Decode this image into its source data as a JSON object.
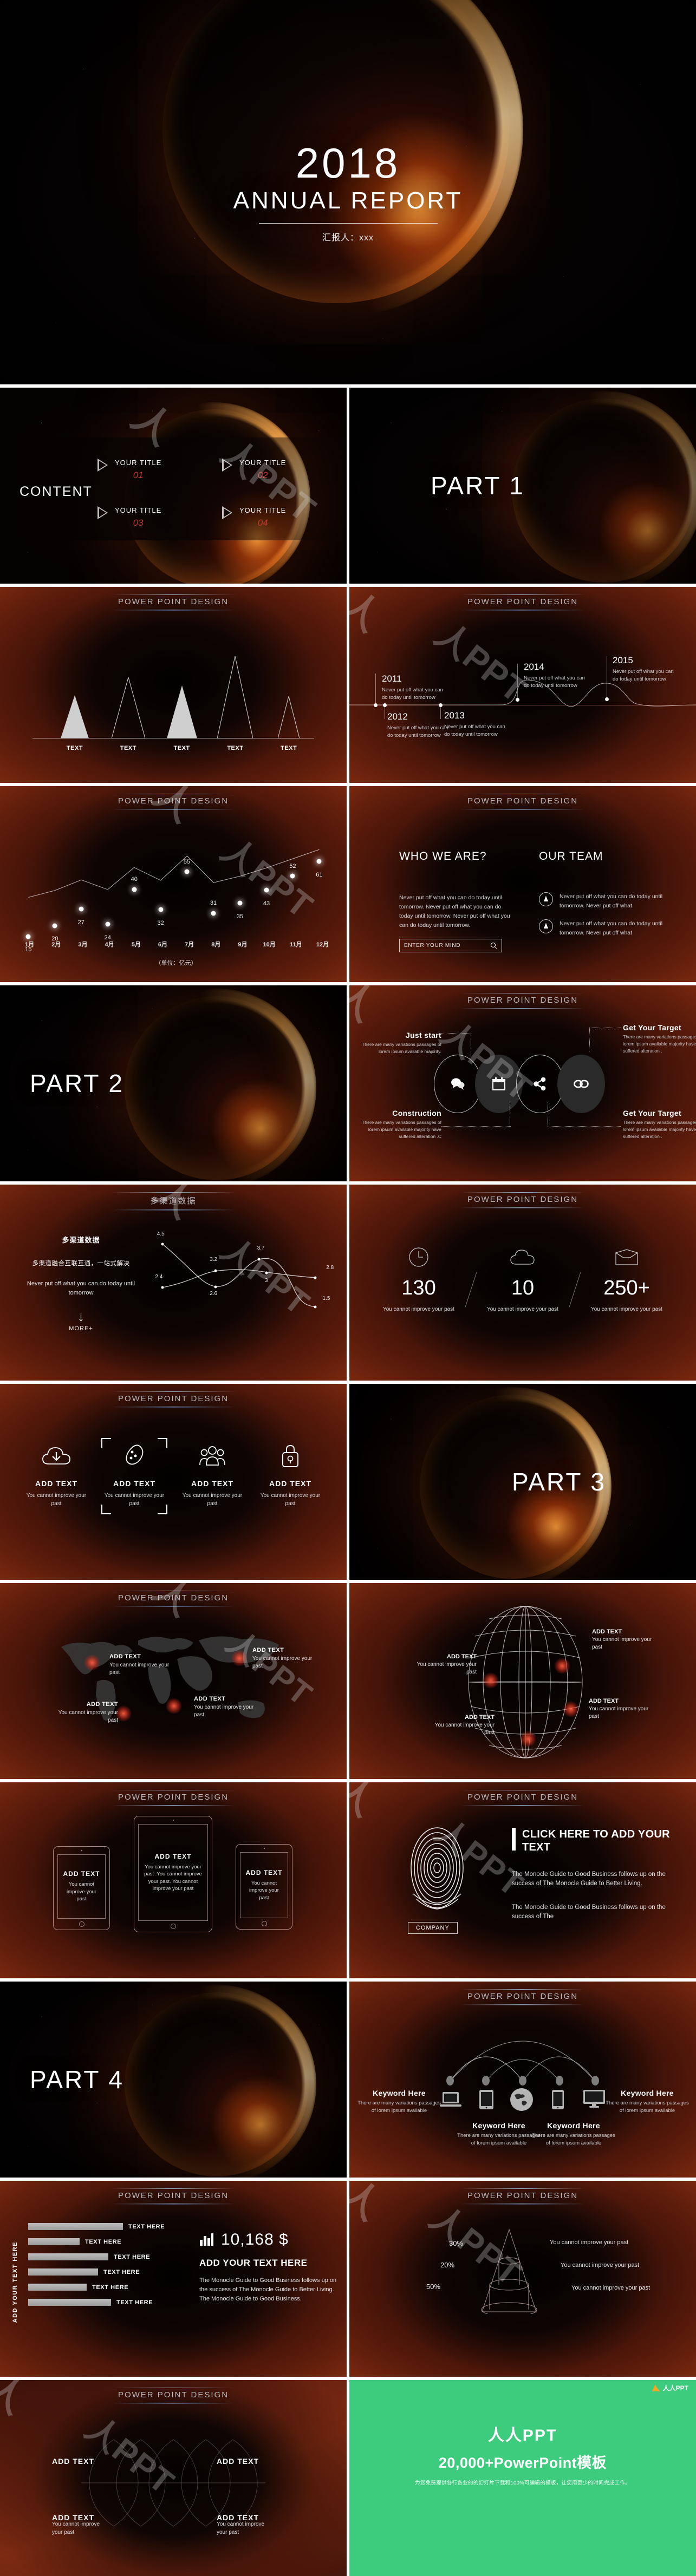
{
  "cover": {
    "year": "2018",
    "subtitle": "ANNUAL REPORT",
    "author": "汇报人：xxx"
  },
  "common": {
    "section_title": "POWER POINT DESIGN",
    "lorem_short": "Never put off what you can do today until tomorrow",
    "you_cannot": "You cannot improve your past",
    "add_text": "ADD TEXT",
    "add_text_sp": "ADD  TEXT",
    "text_here": "TEXT HERE",
    "variations": "There are many variations passages of lorem ipsum available"
  },
  "content": {
    "label": "CONTENT",
    "items": [
      {
        "title": "YOUR TITLE",
        "num": "01"
      },
      {
        "title": "YOUR TITLE",
        "num": "02"
      },
      {
        "title": "YOUR TITLE",
        "num": "03"
      },
      {
        "title": "YOUR TITLE",
        "num": "04"
      }
    ]
  },
  "parts": {
    "part1": "PART 1",
    "part2": "PART 2",
    "part3": "PART 3",
    "part4": "PART 4"
  },
  "triangle_slide": {
    "title": "POWER POINT DESIGN",
    "labels": [
      "TEXT",
      "TEXT",
      "TEXT",
      "TEXT",
      "TEXT"
    ]
  },
  "timeline": {
    "title": "POWER POINT DESIGN",
    "entries": [
      {
        "year": "2011",
        "text": "Never put off what you can do today until tomorrow"
      },
      {
        "year": "2012",
        "text": "Never put off what you can do today until tomorrow"
      },
      {
        "year": "2013",
        "text": "Never put off what you can do today until tomorrow"
      },
      {
        "year": "2014",
        "text": "Never put off what you can do today until tomorrow"
      },
      {
        "year": "2015",
        "text": "Never put off what you can do today until tomorrow"
      }
    ]
  },
  "who_we_are": {
    "title": "POWER POINT DESIGN",
    "heading_left": "WHO WE ARE?",
    "body_left": "Never put off what you can do today until tomorrow. Never put off what you can do today until tomorrow. Never put off what you can do today until tomorrow.",
    "search_placeholder": "ENTER YOUR MIND",
    "heading_right": "OUR TEAM",
    "team": [
      "Never put off what you can do today until tomorrow. Never put off what",
      "Never put off what you can do today until tomorrow. Never put off what"
    ]
  },
  "circles": {
    "title": "POWER POINT DESIGN",
    "labels": [
      {
        "h": "Just start",
        "p": "There are many variations passages of lorem ipsum available majority."
      },
      {
        "h": "Construction",
        "p": "There are many variations passages of lorem ipsum available majority have suffered alteration .C"
      },
      {
        "h": "Get Your Target",
        "p": "There are many variations passages of lorem ipsum available majority have suffered alteration ."
      },
      {
        "h": "Get Your Target",
        "p": "There are many variations passages of lorem ipsum available majority have suffered alteration ."
      }
    ],
    "icons": [
      "chat-icon",
      "calendar-icon",
      "share-icon",
      "link-icon"
    ]
  },
  "stats": {
    "title": "POWER POINT DESIGN",
    "items": [
      {
        "icon": "clock-icon",
        "value": "130",
        "caption": "You cannot improve your past"
      },
      {
        "icon": "cloud-icon",
        "value": "10",
        "caption": "You cannot improve your past"
      },
      {
        "icon": "inbox-icon",
        "value": "250+",
        "caption": "You cannot improve your past"
      }
    ]
  },
  "icon_cards": {
    "title": "POWER POINT DESIGN",
    "cards": [
      {
        "icon": "cloud-download-icon",
        "h": "ADD  TEXT",
        "p": "You cannot improve your past"
      },
      {
        "icon": "tag-icon",
        "h": "ADD  TEXT",
        "p": "You cannot improve your past"
      },
      {
        "icon": "people-icon",
        "h": "ADD  TEXT",
        "p": "You cannot improve your past"
      },
      {
        "icon": "lock-icon",
        "h": "ADD  TEXT",
        "p": "You cannot improve your past"
      }
    ]
  },
  "world_map": {
    "title": "POWER POINT DESIGN",
    "markers": [
      {
        "h": "ADD TEXT",
        "p": "You cannot improve your past"
      },
      {
        "h": "ADD TEXT",
        "p": "You cannot improve your past"
      },
      {
        "h": "ADD TEXT",
        "p": "You cannot improve your past"
      },
      {
        "h": "ADD TEXT",
        "p": "You cannot improve your past"
      }
    ]
  },
  "globe": {
    "markers": [
      {
        "h": "ADD TEXT",
        "p": "You cannot improve your past"
      },
      {
        "h": "ADD TEXT",
        "p": "You cannot improve your past"
      },
      {
        "h": "ADD TEXT",
        "p": "You cannot improve your past"
      },
      {
        "h": "ADD TEXT",
        "p": "You cannot improve your past"
      }
    ]
  },
  "tablets": {
    "title": "POWER POINT DESIGN",
    "devices": [
      {
        "h": "ADD  TEXT",
        "p": "You cannot improve your past"
      },
      {
        "h": "ADD  TEXT",
        "p": "You cannot improve your past .You cannot improve your past. You cannot improve your past"
      },
      {
        "h": "ADD  TEXT",
        "p": "You cannot improve your past"
      }
    ]
  },
  "fingerprint": {
    "title": "POWER POINT DESIGN",
    "heading": "CLICK HERE TO ADD YOUR TEXT",
    "p1": "The Monocle Guide to Good Business follows up on the success of The Monocle Guide to Better Living.",
    "p2": "The Monocle Guide to Good Business follows up on the success of The",
    "company": "COMPANY"
  },
  "keywords": {
    "title": "POWER POINT DESIGN",
    "items": [
      {
        "icon": "laptop-icon",
        "h": "Keyword Here",
        "p": "There are many variations passages of lorem ipsum available"
      },
      {
        "icon": "tablet-icon",
        "h": "Keyword Here",
        "p": "There are many variations passages of lorem ipsum available"
      },
      {
        "icon": "globe-icon",
        "h": "Keyword Here",
        "p": "There are many variations passages of lorem ipsum available"
      },
      {
        "icon": "phone-icon",
        "h": "Keyword Here",
        "p": "There are many variations passages of lorem ipsum available"
      },
      {
        "icon": "monitor-icon",
        "h": "Keyword Here",
        "p": "There are many variations passages of lorem ipsum available"
      }
    ]
  },
  "bars_slide": {
    "title": "POWER POINT DESIGN",
    "vertical_label": "ADD YOUR TEXT HERE",
    "amount": "10,168 $",
    "subheading": "ADD YOUR TEXT HERE",
    "body": "The Monocle Guide to Good Business follows up on the success of The Monocle Guide to Better Living. The Monocle Guide to Good Business."
  },
  "pyramid": {
    "title": "POWER POINT DESIGN",
    "rows": [
      {
        "pct": "30%",
        "text": "You cannot improve your past"
      },
      {
        "pct": "20%",
        "text": "You cannot improve your past"
      },
      {
        "pct": "50%",
        "text": "You cannot improve your past"
      }
    ]
  },
  "ending": {
    "brand": "人人PPT",
    "headline": "20,000+PowerPoint模板",
    "sub": "为您免费提供各行各业的的幻灯片下载和100%可编辑的模板，让您用更少的时间完成工作。",
    "logo_text": "人人PPT",
    "bg": "#3dcc7e"
  },
  "watermark": {
    "text": "人人PPT"
  },
  "chart_data": [
    {
      "type": "bar",
      "title": "POWER POINT DESIGN",
      "categories": [
        "TEXT",
        "TEXT",
        "TEXT",
        "TEXT",
        "TEXT"
      ],
      "values": [
        38,
        58,
        50,
        78,
        34
      ],
      "xlabel": "",
      "ylabel": "",
      "ylim": [
        0,
        100
      ],
      "note": "triangle-shaped bars, alternating filled/outline"
    },
    {
      "type": "line",
      "title": "POWER POINT DESIGN",
      "categories": [
        "1月",
        "2月",
        "3月",
        "4月",
        "5月",
        "6月",
        "7月",
        "8月",
        "9月",
        "10月",
        "11月",
        "12月"
      ],
      "values": [
        15,
        20,
        27,
        24,
        40,
        32,
        55,
        31,
        35,
        43,
        52,
        61
      ],
      "xlabel": "",
      "ylabel": "",
      "unit": "（单位：亿元）",
      "ylim": [
        0,
        70
      ],
      "grid": false,
      "legend": "none"
    },
    {
      "type": "line",
      "title": "多渠道数据",
      "subtitle": "多渠道融合互联互通，一站式解决",
      "x": [
        1,
        2,
        3,
        4
      ],
      "series": [
        {
          "name": "series-1",
          "values": [
            4.5,
            2.6,
            3.7,
            1.5
          ]
        },
        {
          "name": "series-2",
          "values": [
            2.4,
            3.2,
            3.0,
            2.8
          ]
        }
      ],
      "ylim": [
        0,
        5
      ],
      "grid": false,
      "legend": "none"
    },
    {
      "type": "bar",
      "title": "POWER POINT DESIGN",
      "categories": [
        "TEXT HERE",
        "TEXT HERE",
        "TEXT HERE",
        "TEXT HERE",
        "TEXT HERE",
        "TEXT HERE"
      ],
      "values": [
        100,
        65,
        88,
        79,
        67,
        91
      ],
      "orientation": "horizontal",
      "ylabel": "ADD YOUR TEXT HERE",
      "xlim": [
        0,
        110
      ],
      "grid": false,
      "legend": "none"
    },
    {
      "type": "pie",
      "title": "POWER POINT DESIGN",
      "labels": [
        "30%",
        "20%",
        "50%"
      ],
      "values": [
        30,
        20,
        50
      ],
      "note": "3-level pyramid / funnel chart, wireframe"
    }
  ]
}
